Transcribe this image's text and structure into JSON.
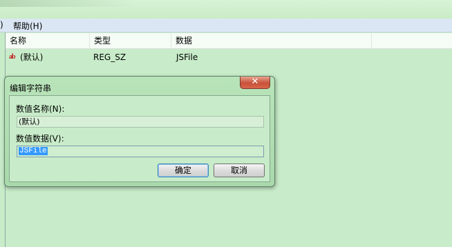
{
  "menu": {
    "left_fragment": ")",
    "help": "帮助(H)"
  },
  "list": {
    "columns": [
      "名称",
      "类型",
      "数据"
    ],
    "rows": [
      {
        "icon": "ab",
        "name": "(默认)",
        "type": "REG_SZ",
        "data": "JSFile"
      }
    ]
  },
  "dialog": {
    "title": "编辑字符串",
    "close_glyph": "✕",
    "name_label": "数值名称(N):",
    "name_value": "(默认)",
    "data_label": "数值数据(V):",
    "data_value": "JSFile",
    "ok_label": "确定",
    "cancel_label": "取消"
  }
}
